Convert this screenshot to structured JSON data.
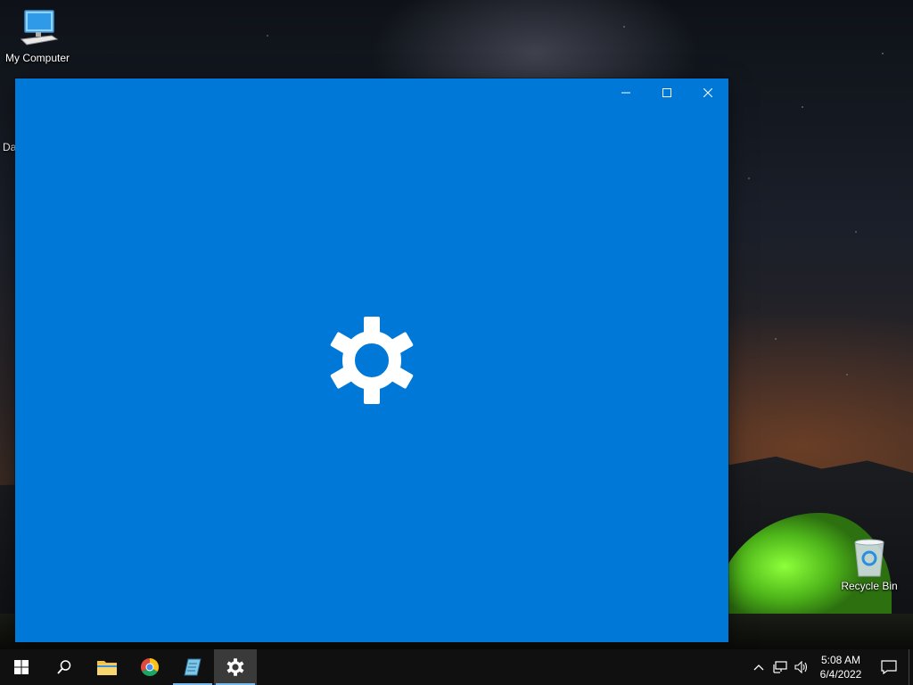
{
  "desktop": {
    "icons": [
      {
        "label": "My Computer",
        "icon": "computer-icon"
      },
      {
        "label": "Recycle Bin",
        "icon": "recycle-bin-icon"
      }
    ],
    "partial_label": "Da"
  },
  "window": {
    "app": "Settings",
    "background_color": "#0078d7",
    "splash_icon": "gear-icon",
    "controls": {
      "minimize": "minimize-icon",
      "maximize": "maximize-icon",
      "close": "close-icon"
    }
  },
  "taskbar": {
    "items": [
      {
        "name": "start",
        "icon": "windows-logo-icon"
      },
      {
        "name": "search",
        "icon": "search-icon"
      },
      {
        "name": "file-explorer",
        "icon": "folder-icon"
      },
      {
        "name": "chrome",
        "icon": "chrome-icon"
      },
      {
        "name": "notepad",
        "icon": "notepad-icon",
        "running": true
      },
      {
        "name": "settings",
        "icon": "gear-icon",
        "running": true,
        "active": true
      }
    ],
    "tray": {
      "icons": [
        "chevron-up-icon",
        "network-icon",
        "volume-icon"
      ],
      "time": "5:08 AM",
      "date": "6/4/2022",
      "notification_icon": "action-center-icon"
    }
  }
}
